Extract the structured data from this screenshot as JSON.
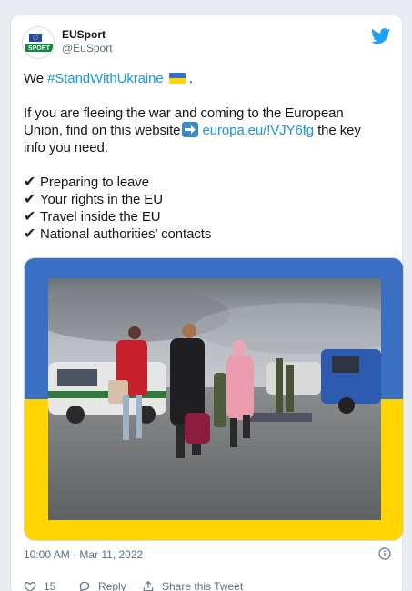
{
  "colors": {
    "accent": "#1b95e0",
    "twitter_blue": "#1da1f2",
    "ukraine_blue": "#3a6fc4",
    "ukraine_yellow": "#ffd500"
  },
  "author": {
    "display_name": "EUSport",
    "handle": "@EuSport",
    "avatar_text": "SPORT",
    "icon": "twitter-bird-icon"
  },
  "tweet": {
    "line1_prefix": "We ",
    "hashtag": "#StandWithUkraine",
    "line1_suffix": " .",
    "para2_line1": "If you are fleeing the war and coming to the European",
    "para2_line2_prefix": "Union, find on this website",
    "url": "europa.eu/!VJY6fg",
    "para2_line2_suffix": "  the key",
    "para2_line3": "info you need:",
    "checklist": [
      "Preparing to leave",
      "Your rights in the EU",
      "Travel inside the EU",
      "National authorities’ contacts"
    ]
  },
  "footer": {
    "timestamp": "10:00 AM · Mar 11, 2022",
    "like_count": "15",
    "reply_label": "Reply",
    "share_label": "Share this Tweet"
  }
}
